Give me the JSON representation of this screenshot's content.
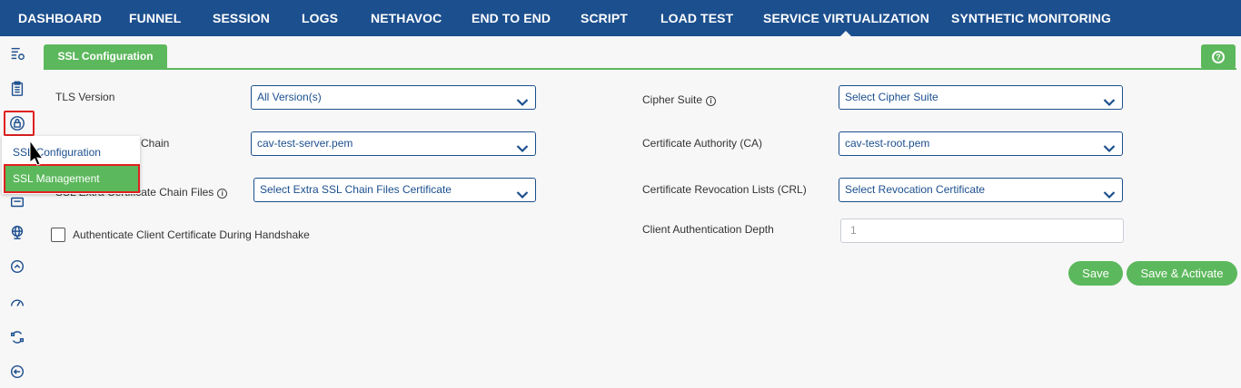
{
  "nav": {
    "items": [
      "DASHBOARD",
      "FUNNEL",
      "SESSION",
      "LOGS",
      "NETHAVOC",
      "END TO END",
      "SCRIPT",
      "LOAD TEST",
      "SERVICE VIRTUALIZATION",
      "SYNTHETIC MONITORING"
    ],
    "active": "SERVICE VIRTUALIZATION"
  },
  "rail": {
    "icons": [
      "settings-list-icon",
      "clipboard-icon",
      "lock-icon",
      "certificate-icon",
      "globe-icon",
      "chevron-up-circle-icon",
      "speedometer-icon",
      "cycle-icon",
      "arrow-left-circle-icon"
    ]
  },
  "tab": {
    "label": "SSL Configuration"
  },
  "help": {
    "label": "?"
  },
  "form": {
    "tls_version": {
      "label": "TLS Version",
      "value": "All Version(s)"
    },
    "cipher_suite": {
      "label": "Cipher Suite",
      "value": "Select Cipher Suite"
    },
    "certificate_chain": {
      "label_visible": "Chain",
      "value": "cav-test-server.pem"
    },
    "certificate_authority": {
      "label": "Certificate Authority (CA)",
      "value": "cav-test-root.pem"
    },
    "extra_chain_files": {
      "label_visible": "SSL Extra Certificate Chain Files",
      "value": "Select Extra SSL Chain Files Certificate"
    },
    "crl": {
      "label": "Certificate Revocation Lists (CRL)",
      "value": "Select Revocation Certificate"
    },
    "authenticate_client": {
      "label": "Authenticate Client Certificate During Handshake",
      "checked": false
    },
    "client_auth_depth": {
      "label": "Client Authentication Depth",
      "placeholder": "1"
    }
  },
  "buttons": {
    "save": "Save",
    "save_activate": "Save & Activate"
  },
  "popup": {
    "item1": "SSL Configuration",
    "item2": "SSL Management"
  },
  "colors": {
    "nav": "#1c4f8e",
    "accent": "#5cb85c",
    "highlight": "#e02020"
  }
}
